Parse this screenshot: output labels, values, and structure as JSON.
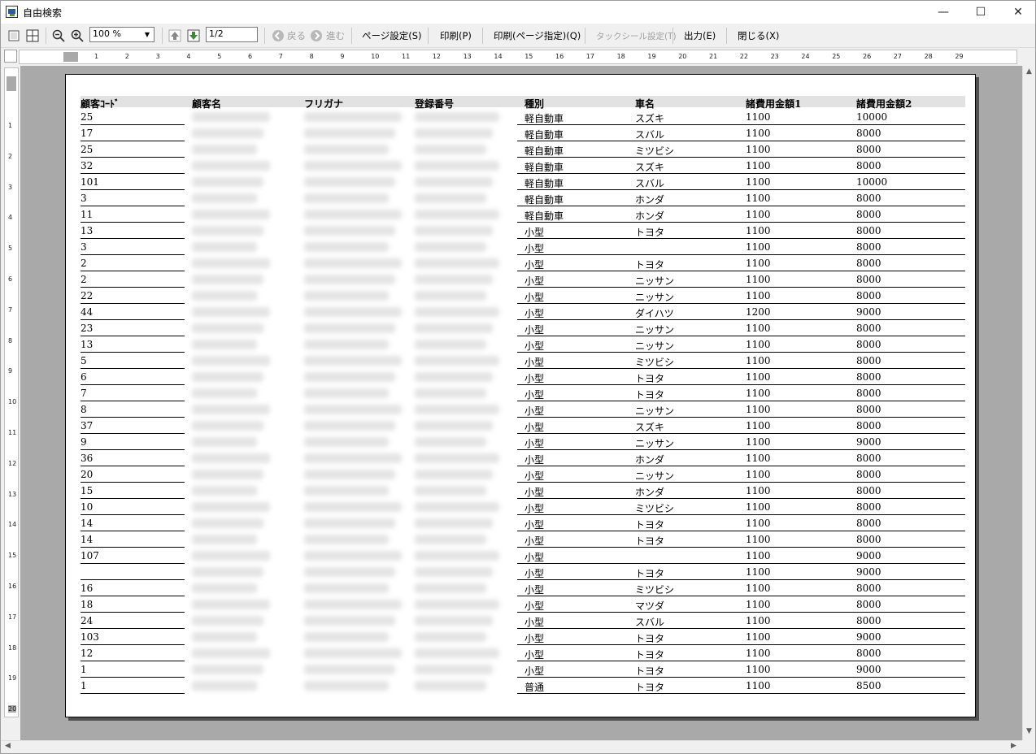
{
  "window": {
    "title": "自由検索",
    "minimize": "—",
    "maximize": "☐",
    "close": "✕"
  },
  "toolbar": {
    "zoom_value": "100 %",
    "page_value": "1/2",
    "back_label": "戻る",
    "forward_label": "進む",
    "page_setup": "ページ設定(S)",
    "print": "印刷(P)",
    "print_range": "印刷(ページ指定)(Q)",
    "tack_seal": "タックシール設定(T)",
    "output": "出力(E)",
    "close": "閉じる(X)"
  },
  "ruler": {
    "h_numbers": [
      "1",
      "2",
      "3",
      "4",
      "5",
      "6",
      "7",
      "8",
      "9",
      "10",
      "11",
      "12",
      "13",
      "14",
      "15",
      "16",
      "17",
      "18",
      "19",
      "20",
      "21",
      "22",
      "23",
      "24",
      "25",
      "26",
      "27",
      "28",
      "29"
    ],
    "v_numbers": [
      "1",
      "2",
      "3",
      "4",
      "5",
      "6",
      "7",
      "8",
      "9",
      "10",
      "11",
      "12",
      "13",
      "14",
      "15",
      "16",
      "17",
      "18",
      "19",
      "20"
    ]
  },
  "table": {
    "headers": [
      "顧客ｺｰﾄﾞ",
      "顧客名",
      "フリガナ",
      "登録番号",
      "種別",
      "車名",
      "諸費用金額1",
      "諸費用金額2"
    ],
    "rows": [
      {
        "code": "25",
        "type": "軽自動車",
        "car": "スズキ",
        "amt1": "1100",
        "amt2": "10000"
      },
      {
        "code": "17",
        "type": "軽自動車",
        "car": "スバル",
        "amt1": "1100",
        "amt2": "8000"
      },
      {
        "code": "25",
        "type": "軽自動車",
        "car": "ミツビシ",
        "amt1": "1100",
        "amt2": "8000"
      },
      {
        "code": "32",
        "type": "軽自動車",
        "car": "スズキ",
        "amt1": "1100",
        "amt2": "8000"
      },
      {
        "code": "101",
        "type": "軽自動車",
        "car": "スバル",
        "amt1": "1100",
        "amt2": "10000"
      },
      {
        "code": "3",
        "type": "軽自動車",
        "car": "ホンダ",
        "amt1": "1100",
        "amt2": "8000"
      },
      {
        "code": "11",
        "type": "軽自動車",
        "car": "ホンダ",
        "amt1": "1100",
        "amt2": "8000"
      },
      {
        "code": "13",
        "type": "小型",
        "car": "トヨタ",
        "amt1": "1100",
        "amt2": "8000"
      },
      {
        "code": "3",
        "type": "小型",
        "car": "",
        "amt1": "1100",
        "amt2": "8000"
      },
      {
        "code": "2",
        "type": "小型",
        "car": "トヨタ",
        "amt1": "1100",
        "amt2": "8000"
      },
      {
        "code": "2",
        "type": "小型",
        "car": "ニッサン",
        "amt1": "1100",
        "amt2": "8000"
      },
      {
        "code": "22",
        "type": "小型",
        "car": "ニッサン",
        "amt1": "1100",
        "amt2": "8000"
      },
      {
        "code": "44",
        "type": "小型",
        "car": "ダイハツ",
        "amt1": "1200",
        "amt2": "9000"
      },
      {
        "code": "23",
        "type": "小型",
        "car": "ニッサン",
        "amt1": "1100",
        "amt2": "8000"
      },
      {
        "code": "13",
        "type": "小型",
        "car": "ニッサン",
        "amt1": "1100",
        "amt2": "8000"
      },
      {
        "code": "5",
        "type": "小型",
        "car": "ミツビシ",
        "amt1": "1100",
        "amt2": "8000"
      },
      {
        "code": "6",
        "type": "小型",
        "car": "トヨタ",
        "amt1": "1100",
        "amt2": "8000"
      },
      {
        "code": "7",
        "type": "小型",
        "car": "トヨタ",
        "amt1": "1100",
        "amt2": "8000"
      },
      {
        "code": "8",
        "type": "小型",
        "car": "ニッサン",
        "amt1": "1100",
        "amt2": "8000"
      },
      {
        "code": "37",
        "type": "小型",
        "car": "スズキ",
        "amt1": "1100",
        "amt2": "8000"
      },
      {
        "code": "9",
        "type": "小型",
        "car": "ニッサン",
        "amt1": "1100",
        "amt2": "9000"
      },
      {
        "code": "36",
        "type": "小型",
        "car": "ホンダ",
        "amt1": "1100",
        "amt2": "8000"
      },
      {
        "code": "20",
        "type": "小型",
        "car": "ニッサン",
        "amt1": "1100",
        "amt2": "8000"
      },
      {
        "code": "15",
        "type": "小型",
        "car": "ホンダ",
        "amt1": "1100",
        "amt2": "8000"
      },
      {
        "code": "10",
        "type": "小型",
        "car": "ミツビシ",
        "amt1": "1100",
        "amt2": "8000"
      },
      {
        "code": "14",
        "type": "小型",
        "car": "トヨタ",
        "amt1": "1100",
        "amt2": "8000"
      },
      {
        "code": "14",
        "type": "小型",
        "car": "トヨタ",
        "amt1": "1100",
        "amt2": "8000"
      },
      {
        "code": "107",
        "type": "小型",
        "car": "",
        "amt1": "1100",
        "amt2": "9000"
      },
      {
        "code": "",
        "type": "小型",
        "car": "トヨタ",
        "amt1": "1100",
        "amt2": "9000"
      },
      {
        "code": "16",
        "type": "小型",
        "car": "ミツビシ",
        "amt1": "1100",
        "amt2": "8000"
      },
      {
        "code": "18",
        "type": "小型",
        "car": "マツダ",
        "amt1": "1100",
        "amt2": "8000"
      },
      {
        "code": "24",
        "type": "小型",
        "car": "スバル",
        "amt1": "1100",
        "amt2": "8000"
      },
      {
        "code": "103",
        "type": "小型",
        "car": "トヨタ",
        "amt1": "1100",
        "amt2": "9000"
      },
      {
        "code": "12",
        "type": "小型",
        "car": "トヨタ",
        "amt1": "1100",
        "amt2": "8000"
      },
      {
        "code": "1",
        "type": "小型",
        "car": "トヨタ",
        "amt1": "1100",
        "amt2": "9000"
      },
      {
        "code": "1",
        "type": "普通",
        "car": "トヨタ",
        "amt1": "1100",
        "amt2": "8500"
      }
    ]
  }
}
